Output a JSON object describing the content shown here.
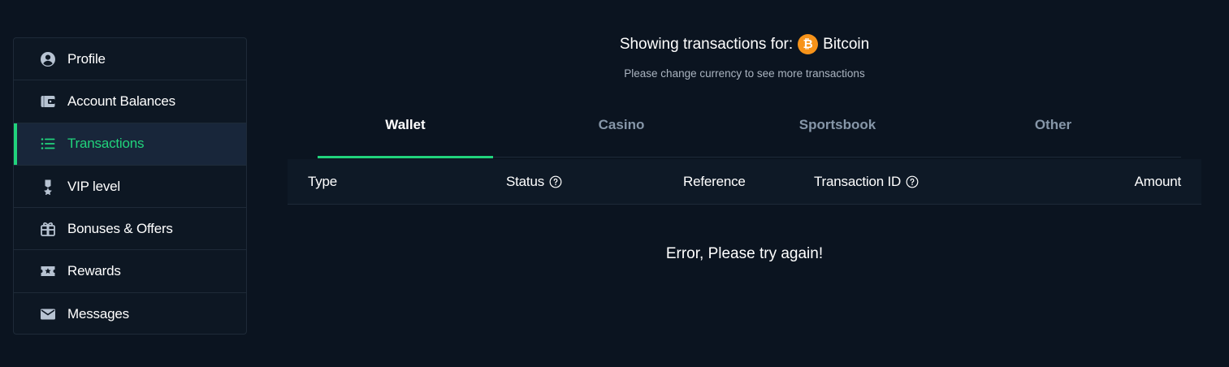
{
  "sidebar": {
    "items": [
      {
        "label": "Profile",
        "icon": "user-circle-icon"
      },
      {
        "label": "Account Balances",
        "icon": "wallet-icon"
      },
      {
        "label": "Transactions",
        "icon": "list-icon",
        "active": true
      },
      {
        "label": "VIP level",
        "icon": "medal-icon"
      },
      {
        "label": "Bonuses & Offers",
        "icon": "gift-icon"
      },
      {
        "label": "Rewards",
        "icon": "star-ticket-icon"
      },
      {
        "label": "Messages",
        "icon": "envelope-icon"
      }
    ]
  },
  "header": {
    "showing_prefix": "Showing transactions for:",
    "currency": "Bitcoin",
    "currency_icon": "bitcoin-icon",
    "note": "Please change currency to see more transactions"
  },
  "tabs": [
    {
      "label": "Wallet",
      "active": true
    },
    {
      "label": "Casino"
    },
    {
      "label": "Sportsbook"
    },
    {
      "label": "Other"
    }
  ],
  "table": {
    "columns": {
      "type": "Type",
      "status": "Status",
      "reference": "Reference",
      "transaction_id": "Transaction ID",
      "amount": "Amount"
    }
  },
  "error_message": "Error, Please try again!",
  "colors": {
    "accent": "#21d37c",
    "background": "#0b1420",
    "bitcoin": "#f7931a"
  }
}
